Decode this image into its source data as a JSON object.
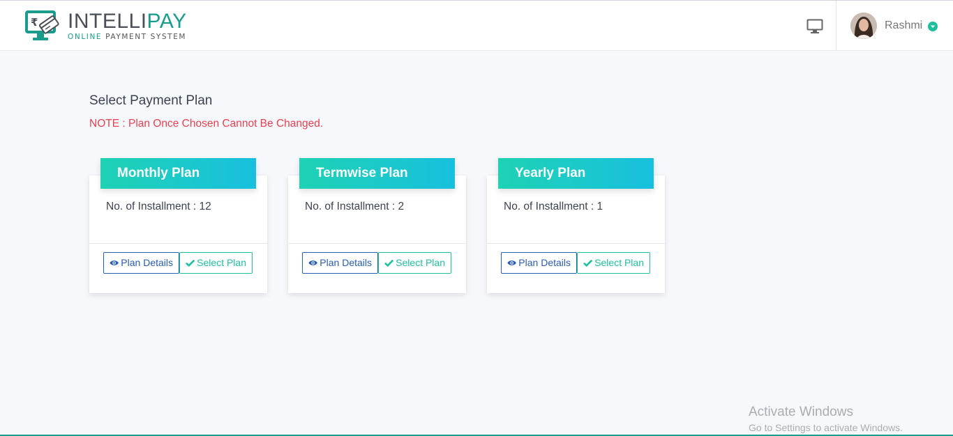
{
  "brand": {
    "name_part1": "INTELLI",
    "name_part2": "PAY",
    "tagline_hl": "ONLINE",
    "tagline_rest": " PAYMENT SYSTEM"
  },
  "header": {
    "user_name": "Rashmi",
    "icons": [
      "monitor-icon",
      "chevron-down-circle-icon"
    ]
  },
  "page": {
    "title": "Select Payment Plan",
    "note": "NOTE : Plan Once Chosen Cannot Be Changed."
  },
  "plans": [
    {
      "title": "Monthly Plan",
      "info": "No. of Installment : 12",
      "details_label": "Plan Details",
      "select_label": "Select Plan"
    },
    {
      "title": "Termwise Plan",
      "info": "No. of Installment : 2",
      "details_label": "Plan Details",
      "select_label": "Select Plan"
    },
    {
      "title": "Yearly Plan",
      "info": "No. of Installment : 1",
      "details_label": "Plan Details",
      "select_label": "Select Plan"
    }
  ],
  "watermark": {
    "line1": "Activate Windows",
    "line2": "Go to Settings to activate Windows."
  },
  "colors": {
    "brand_teal": "#1a9c8d",
    "note_red": "#e8414f",
    "header_gradient_start": "#1fd2b4",
    "header_gradient_end": "#18c0de",
    "details_blue": "#2a5db0",
    "select_green": "#1fbf9e"
  }
}
